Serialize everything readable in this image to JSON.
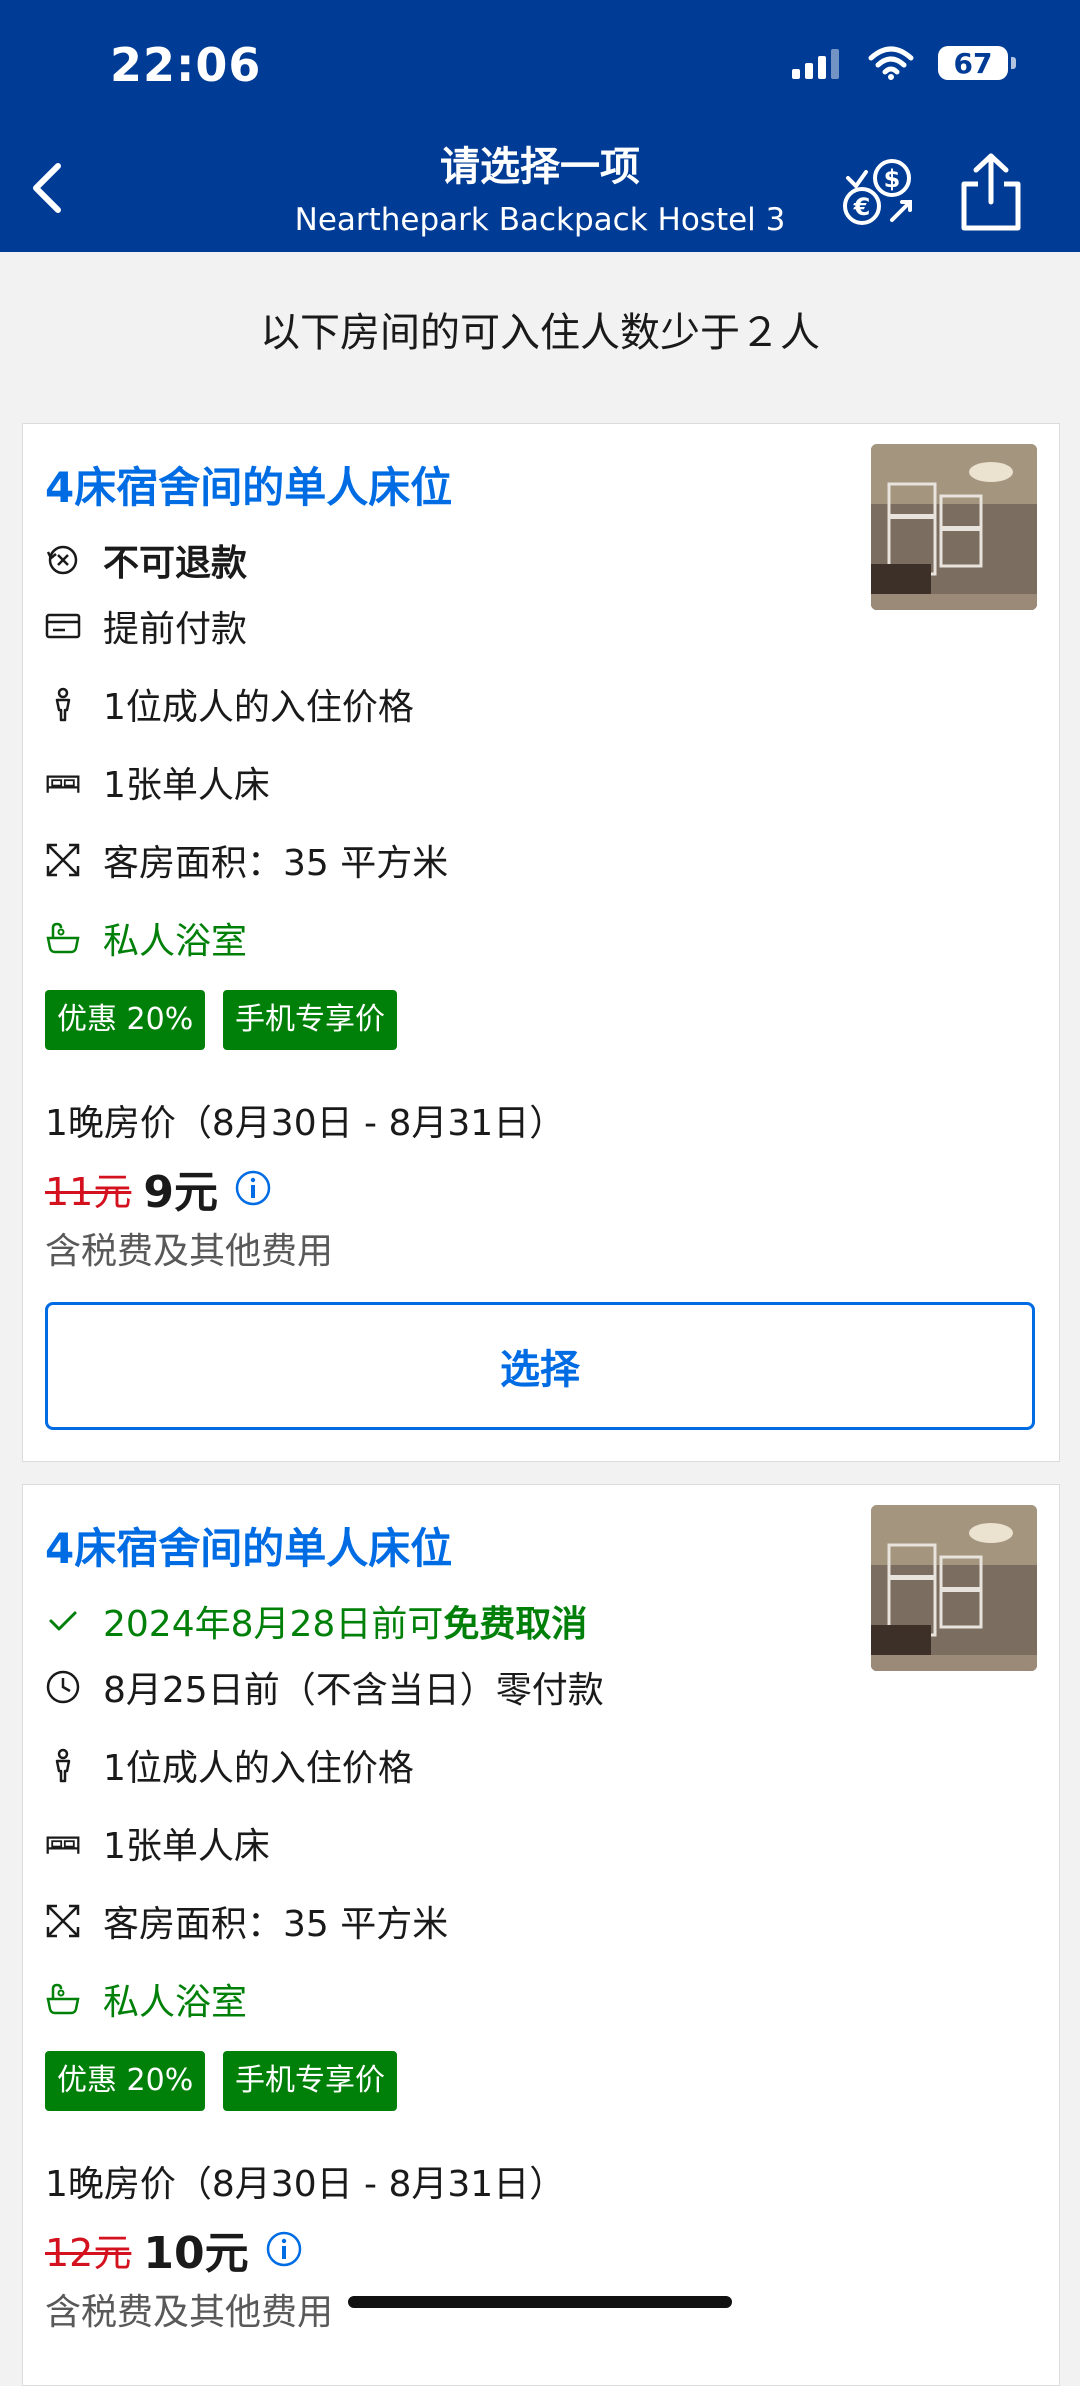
{
  "status_bar": {
    "time": "22:06",
    "battery": "67"
  },
  "nav": {
    "title": "请选择一项",
    "subtitle": "Nearthepark Backpack Hostel 3"
  },
  "occupancy_note": "以下房间的可入住人数少于２人",
  "rooms": [
    {
      "title": "4床宿舍间的单人床位",
      "policy": "不可退款",
      "payment": "提前付款",
      "occupancy": "1位成人的入住价格",
      "bed": "1张单人床",
      "size": "客房面积：35 平方米",
      "bathroom": "私人浴室",
      "badges": [
        "优惠 20%",
        "手机专享价"
      ],
      "price_label": "1晚房价（8月30日 - 8月31日）",
      "old_price": "11元",
      "new_price": "9元",
      "tax_note": "含税费及其他费用",
      "select_label": "选择"
    },
    {
      "title": "4床宿舍间的单人床位",
      "policy_prefix": "2024年8月28日前可",
      "policy_bold": "免费取消",
      "payment": "8月25日前（不含当日）零付款",
      "occupancy": "1位成人的入住价格",
      "bed": "1张单人床",
      "size": "客房面积：35 平方米",
      "bathroom": "私人浴室",
      "badges": [
        "优惠 20%",
        "手机专享价"
      ],
      "price_label": "1晚房价（8月30日 - 8月31日）",
      "old_price": "12元",
      "new_price": "10元",
      "tax_note": "含税费及其他费用"
    }
  ],
  "colors": {
    "brand_blue": "#003b95",
    "link_blue": "#006ce4",
    "deal_green": "#008009",
    "old_price_red": "#d4111e"
  }
}
